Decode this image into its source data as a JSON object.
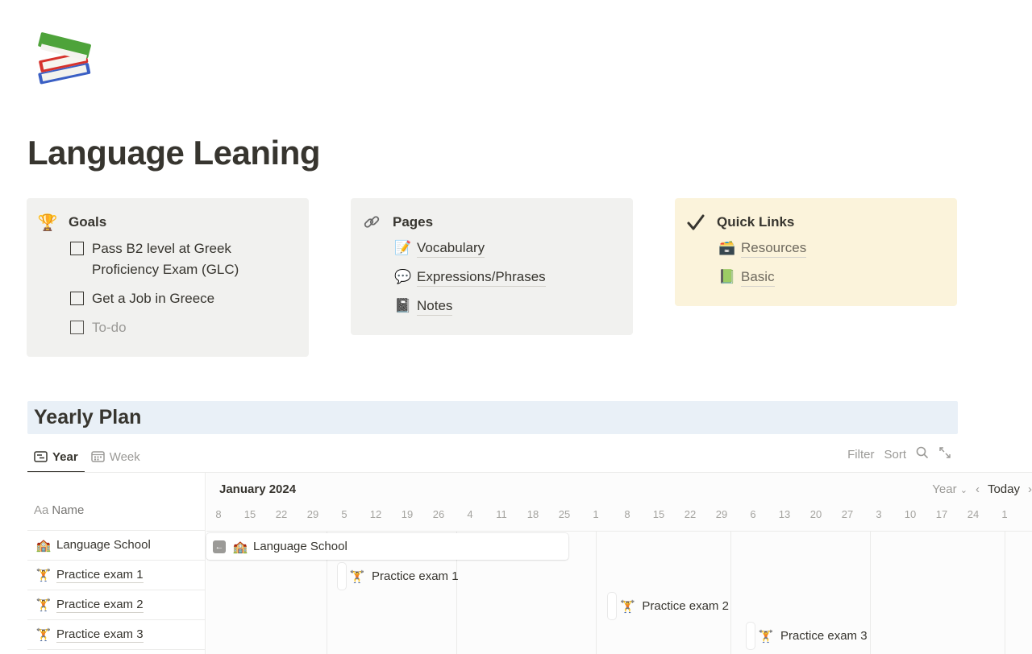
{
  "page": {
    "icon": "books-icon",
    "title": "Language Leaning"
  },
  "goals": {
    "icon": "trophy-icon",
    "title": "Goals",
    "items": [
      {
        "label": "Pass B2 level at Greek Proficiency Exam (GLC)",
        "checked": false
      },
      {
        "label": "Get a Job in Greece",
        "checked": false
      },
      {
        "label": "To-do",
        "checked": false,
        "placeholder": true
      }
    ]
  },
  "pages": {
    "icon": "link-icon",
    "title": "Pages",
    "items": [
      {
        "icon": "memo-icon",
        "emoji": "📝",
        "label": "Vocabulary"
      },
      {
        "icon": "speech-balloon-icon",
        "emoji": "💬",
        "label": "Expressions/Phrases"
      },
      {
        "icon": "notebook-icon",
        "emoji": "📓",
        "label": "Notes"
      }
    ]
  },
  "quick_links": {
    "icon": "checkmark-icon",
    "title": "Quick Links",
    "items": [
      {
        "icon": "card-box-icon",
        "emoji": "🗃️",
        "label": "Resources"
      },
      {
        "icon": "green-book-icon",
        "emoji": "📗",
        "label": "Basic"
      }
    ]
  },
  "yearly_plan": {
    "heading": "Yearly Plan",
    "tabs": [
      {
        "label": "Year",
        "icon": "timeline-icon",
        "active": true
      },
      {
        "label": "Week",
        "icon": "calendar-icon",
        "active": false
      }
    ],
    "toolbar": {
      "filter": "Filter",
      "sort": "Sort",
      "search_icon": "search-icon",
      "expand_icon": "expand-icon"
    },
    "timeline": {
      "month_label": "January 2024",
      "name_header_prefix": "Aa",
      "name_header": "Name",
      "scale_select": "Year",
      "today": "Today",
      "ticks": [
        "8",
        "15",
        "22",
        "29",
        "5",
        "12",
        "19",
        "26",
        "4",
        "11",
        "18",
        "25",
        "1",
        "8",
        "15",
        "22",
        "29",
        "6",
        "13",
        "20",
        "27",
        "3",
        "10",
        "17",
        "24",
        "1"
      ],
      "rows": [
        {
          "emoji": "🏫",
          "icon": "school-icon",
          "name": "Language School"
        },
        {
          "emoji": "🏋️",
          "icon": "weightlifter-icon",
          "name": "Practice exam 1"
        },
        {
          "emoji": "🏋️",
          "icon": "weightlifter-icon",
          "name": "Practice exam 2"
        },
        {
          "emoji": "🏋️",
          "icon": "weightlifter-icon",
          "name": "Practice exam 3"
        }
      ],
      "bars": [
        {
          "row": 0,
          "type": "range",
          "label": "Language School",
          "emoji": "🏫",
          "start_tick": 0,
          "end_tick": 11.5
        },
        {
          "row": 1,
          "type": "milestone",
          "label": "Practice exam 1",
          "emoji": "🏋️",
          "tick": 4
        },
        {
          "row": 2,
          "type": "milestone",
          "label": "Practice exam 2",
          "emoji": "🏋️",
          "tick": 12.6
        },
        {
          "row": 3,
          "type": "milestone",
          "label": "Practice exam 3",
          "emoji": "🏋️",
          "tick": 17
        }
      ]
    }
  }
}
